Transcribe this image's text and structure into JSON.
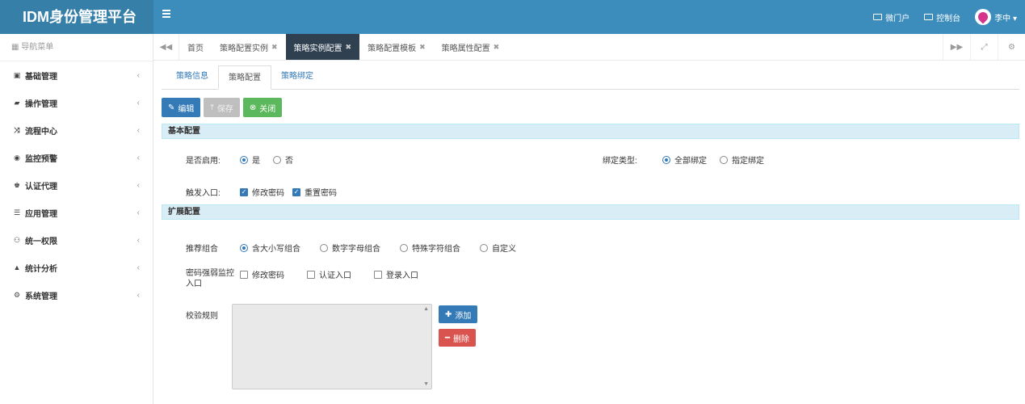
{
  "header": {
    "brand": "IDM身份管理平台",
    "portal_label": "微门户",
    "console_label": "控制台",
    "user_label": "李中 ▾"
  },
  "sidebar": {
    "title": "导航菜单",
    "items": [
      {
        "label": "基础管理",
        "icon": "id-card-icon",
        "glyph": "▣"
      },
      {
        "label": "操作管理",
        "icon": "book-icon",
        "glyph": "▰"
      },
      {
        "label": "流程中心",
        "icon": "random-icon",
        "glyph": "⤨"
      },
      {
        "label": "监控预警",
        "icon": "eye-icon",
        "glyph": "◉"
      },
      {
        "label": "认证代理",
        "icon": "users-icon",
        "glyph": "♚"
      },
      {
        "label": "应用管理",
        "icon": "list-icon",
        "glyph": "☰"
      },
      {
        "label": "统一权限",
        "icon": "sitemap-icon",
        "glyph": "⚇"
      },
      {
        "label": "统计分析",
        "icon": "area-chart-icon",
        "glyph": "▲"
      },
      {
        "label": "系统管理",
        "icon": "cogs-icon",
        "glyph": "⚙"
      }
    ]
  },
  "tabs": {
    "back": "◀◀",
    "forward": "▶▶",
    "items": [
      {
        "label": "首页",
        "closable": false
      },
      {
        "label": "策略配置实例",
        "closable": true
      },
      {
        "label": "策略实例配置",
        "closable": true,
        "active": true
      },
      {
        "label": "策略配置模板",
        "closable": true
      },
      {
        "label": "策略属性配置",
        "closable": true
      }
    ]
  },
  "subtabs": [
    "策略信息",
    "策略配置",
    "策略绑定"
  ],
  "toolbar": {
    "edit_label": "编辑",
    "save_label": "保存",
    "close_label": "关闭"
  },
  "basic": {
    "title": "基本配置",
    "enable_label": "是否启用:",
    "enable_yes": "是",
    "enable_no": "否",
    "bind_label": "绑定类型:",
    "bind_all": "全部绑定",
    "bind_specific": "指定绑定",
    "trigger_label": "触发入口:",
    "trigger_opt1": "修改密码",
    "trigger_opt2": "重置密码"
  },
  "extended": {
    "title": "扩展配置",
    "recommend_label": "推荐组合",
    "recommend_opts": [
      "含大小写组合",
      "数字字母组合",
      "特殊字符组合",
      "自定义"
    ],
    "monitor_label": "密码强弱监控入口",
    "monitor_opts": [
      "修改密码",
      "认证入口",
      "登录入口"
    ],
    "rule_label": "校验规则",
    "add_label": "添加",
    "delete_label": "删除"
  }
}
